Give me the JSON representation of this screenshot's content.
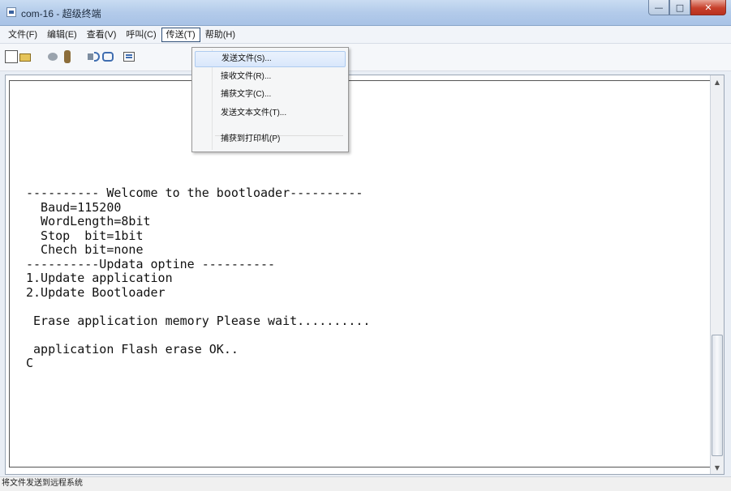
{
  "window": {
    "title": "com-16 - 超级终端",
    "controls": [
      "minimize-icon",
      "maximize-icon",
      "close-icon"
    ]
  },
  "menubar": {
    "items": [
      {
        "label": "文件(F)"
      },
      {
        "label": "编辑(E)"
      },
      {
        "label": "查看(V)"
      },
      {
        "label": "呼叫(C)"
      },
      {
        "label": "传送(T)",
        "active": true
      },
      {
        "label": "帮助(H)"
      }
    ]
  },
  "toolbar": {
    "icons": [
      "new-icon",
      "open-icon",
      "connect-icon",
      "disconnect-icon",
      "send-icon",
      "receive-icon",
      "properties-icon"
    ]
  },
  "transfer_menu": {
    "items": [
      {
        "label": "发送文件(S)...",
        "highlighted": true
      },
      {
        "label": "接收文件(R)..."
      },
      {
        "label": "捕获文字(C)..."
      },
      {
        "label": "发送文本文件(T)..."
      },
      {
        "label": "捕获到打印机(P)"
      }
    ]
  },
  "terminal": {
    "text": "---------- Welcome to the bootloader----------\n  Baud=115200\n  WordLength=8bit\n  Stop  bit=1bit\n  Chech bit=none\n----------Updata optine ----------\n1.Update application\n2.Update Bootloader\n\n Erase application memory Please wait..........\n\n application Flash erase OK..\nC"
  },
  "statusbar": {
    "text": "将文件发送到远程系统"
  }
}
